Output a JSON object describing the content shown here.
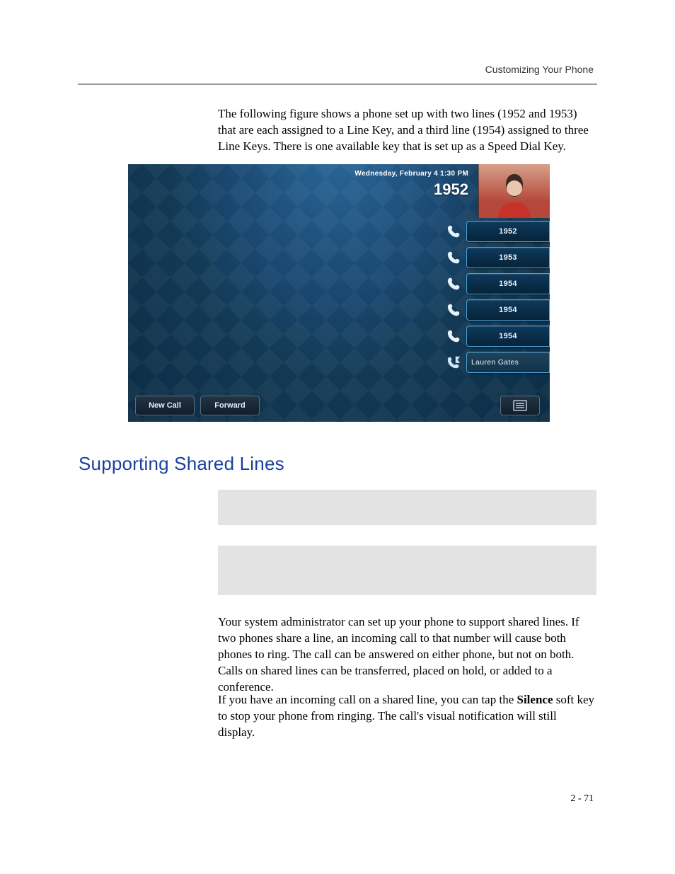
{
  "header": {
    "running_head": "Customizing Your Phone"
  },
  "intro": "The following figure shows a phone set up with two lines (1952 and 1953) that are each assigned to a Line Key, and a third line (1954) assigned to three Line Keys. There is one available key that is set up as a Speed Dial Key.",
  "phone": {
    "date_time": "Wednesday, February 4  1:30 PM",
    "extension": "1952",
    "line_keys": [
      {
        "label": "1952",
        "type": "line"
      },
      {
        "label": "1953",
        "type": "line"
      },
      {
        "label": "1954",
        "type": "line"
      },
      {
        "label": "1954",
        "type": "line"
      },
      {
        "label": "1954",
        "type": "line"
      },
      {
        "label": "Lauren Gates",
        "type": "speeddial"
      }
    ],
    "softkeys": [
      {
        "label": "New Call"
      },
      {
        "label": "Forward"
      }
    ]
  },
  "section_heading": "Supporting Shared Lines",
  "body": {
    "p1": "Your system administrator can set up your phone to support shared lines. If two phones share a line, an incoming call to that number will cause both phones to ring. The call can be answered on either phone, but not on both. Calls on shared lines can be transferred, placed on hold, or added to a conference.",
    "p2_prefix": "If you have an incoming call on a shared line, you can tap the ",
    "p2_bold": "Silence",
    "p2_suffix": " soft key to stop your phone from ringing. The call's visual notification will still display."
  },
  "page_number": "2 - 71"
}
